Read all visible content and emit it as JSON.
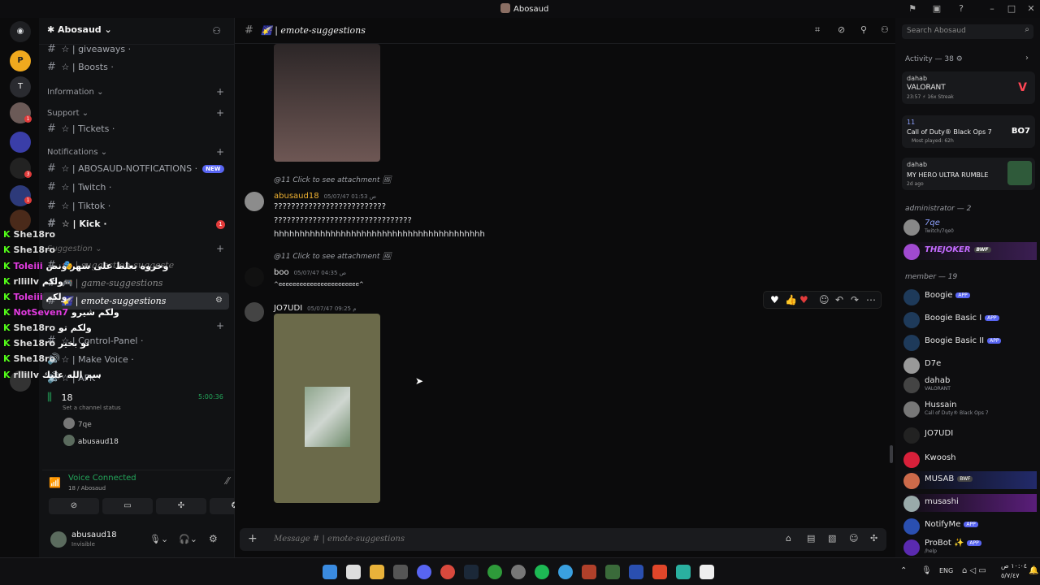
{
  "titlebar": {
    "title": "Abosaud"
  },
  "server": {
    "name": "Abosaud"
  },
  "channels": {
    "giveaways": "giveaways ·",
    "boosts": "Boosts ·",
    "cat_information": "Information",
    "cat_support": "Support",
    "tickets": "Tickets ·",
    "cat_notifications": "Notifications",
    "notif": "ABOSAUD-NOTFICATIONS ·",
    "new_badge": "NEW",
    "twitch": "Twitch ·",
    "tiktok": "Tiktok ·",
    "kick": "Kick ·",
    "kick_badge": "1",
    "cat_suggestion": "Suggestion",
    "suggest_other": "| suggestion-suggeste",
    "game_suggestions": "| game-suggestions",
    "emote_suggestions": "| emote-suggestions",
    "control_panel": "Control-Panel ·",
    "make_voice": "Make Voice ·",
    "afk": "AFK ·",
    "voice_channel": "18",
    "voice_time": "5:00:36",
    "channel_status": "Set a channel status",
    "voice_members": [
      "7qe",
      "abusaud18"
    ]
  },
  "overlay": [
    {
      "name": "She18ro",
      "text": ""
    },
    {
      "name": "She18ro",
      "text": ""
    },
    {
      "name": "Toleiii",
      "text": "وحروه بعلط على شهر ونص"
    },
    {
      "name": "rllillv",
      "text": "ولكم"
    },
    {
      "name": "Toleiii",
      "text": "ولكم"
    },
    {
      "name": "NotSeven7",
      "text": "ولكم شيرو"
    },
    {
      "name": "She18ro",
      "text": "ولكم تو"
    },
    {
      "name": "She18ro",
      "text": "تو بخير"
    },
    {
      "name": "She18ro",
      "text": ""
    },
    {
      "name": "rllillv",
      "text": "سم الله عليك"
    }
  ],
  "voice_panel": {
    "status": "Voice Connected",
    "sub": "18 / Abosaud"
  },
  "user_panel": {
    "name": "abusaud18",
    "status": "Invisible"
  },
  "chat": {
    "channel_name": "| emote-suggestions",
    "reply1": "@11 Click to see attachment",
    "msg1_author": "abusaud18",
    "msg1_time": "05/07/47 01:53 ص",
    "msg1_lines": [
      "??????????????????????????",
      "????????????????????????????????",
      "hhhhhhhhhhhhhhhhhhhhhhhhhhhhhhhhhhhhhhhhh"
    ],
    "reply2": "@11 Click to see attachment",
    "msg2_author": "boo",
    "msg2_time": "05/07/47 04:35 ص",
    "msg2_text": "^eeeeeeeeeeeeeeeeeeeeeee^",
    "msg3_author": "JO7UDI",
    "msg3_time": "05/07/47 09:25 م",
    "composer_placeholder": "Message # | emote-suggestions"
  },
  "search": {
    "placeholder": "Search Abosaud"
  },
  "activity": {
    "header": "Activity — 38",
    "cards": [
      {
        "user": "dahab",
        "game": "VALORANT",
        "sub": "23:57  ⚡ 16x Streak"
      },
      {
        "user": "11",
        "game": "Call of Duty® Black Ops 7",
        "sub": "Most played: 62h"
      },
      {
        "user": "dahab",
        "game": "MY HERO ULTRA RUMBLE",
        "sub": "2d ago"
      }
    ]
  },
  "members": {
    "admin_header": "administrator — 2",
    "admins": [
      {
        "name": "7qe",
        "sub": "Twitch/7qe0",
        "color": "#8ea2ff"
      },
      {
        "name": "THEJOKER",
        "sub": "",
        "color": "#c46bff",
        "badge": "BWF"
      }
    ],
    "member_header": "member — 19",
    "list": [
      {
        "name": "Boogie",
        "sub": "",
        "app": "APP"
      },
      {
        "name": "Boogie Basic I",
        "sub": "",
        "app": "APP"
      },
      {
        "name": "Boogie Basic II",
        "sub": "",
        "app": "APP"
      },
      {
        "name": "D7e",
        "sub": "",
        "app": ""
      },
      {
        "name": "dahab",
        "sub": "VALORANT",
        "app": ""
      },
      {
        "name": "Hussain",
        "sub": "Call of Duty® Black Ops 7",
        "app": ""
      },
      {
        "name": "JO7UDI",
        "sub": "",
        "app": ""
      },
      {
        "name": "Kwoosh",
        "sub": "",
        "app": ""
      },
      {
        "name": "MUSAB",
        "sub": "",
        "app": "",
        "badge": "BWF"
      },
      {
        "name": "musashi",
        "sub": "",
        "app": ""
      },
      {
        "name": "NotifyMe",
        "sub": "",
        "app": "APP"
      },
      {
        "name": "ProBot ✨",
        "sub": "/help",
        "app": "APP"
      }
    ]
  },
  "taskbar": {
    "lang": "ENG",
    "time": "١٠:٠٤ ص",
    "date": "٥/٧/٤٧"
  },
  "colors": {
    "accent": "#5865f2",
    "kick": "#53fc18",
    "online": "#23a55a",
    "danger": "#e23b3b"
  }
}
